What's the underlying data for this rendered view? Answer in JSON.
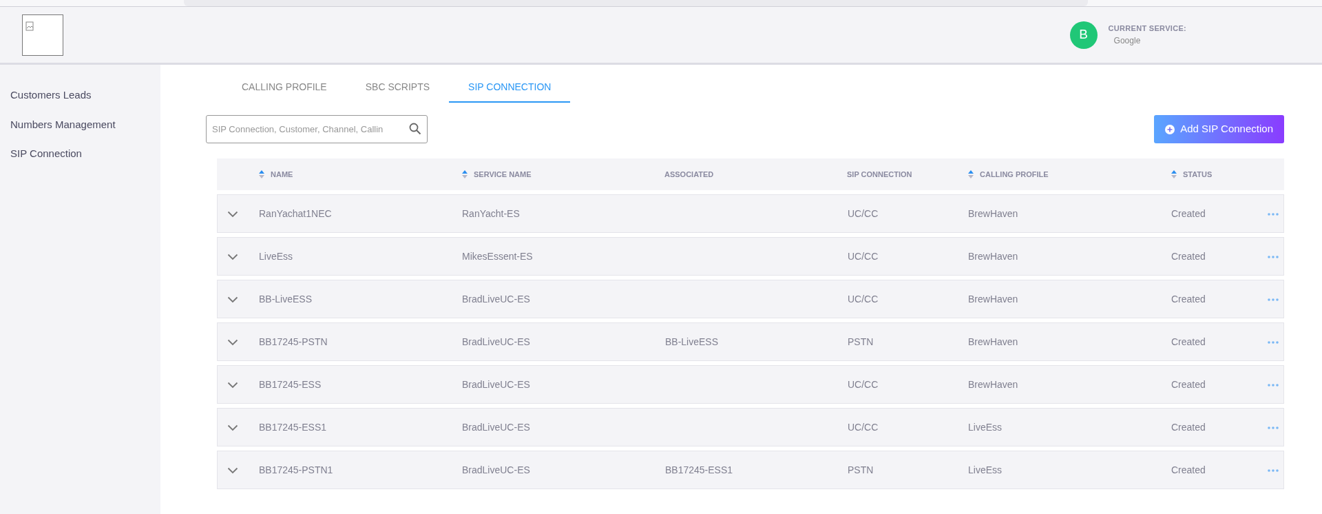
{
  "header": {
    "avatar_letter": "B",
    "service_label": "CURRENT SERVICE:",
    "service_name": "Google"
  },
  "sidebar": {
    "items": [
      {
        "label": "Customers Leads"
      },
      {
        "label": "Numbers Management"
      },
      {
        "label": "SIP Connection"
      }
    ]
  },
  "tabs": [
    {
      "label": "CALLING PROFILE",
      "selected": false
    },
    {
      "label": "SBC SCRIPTS",
      "selected": false
    },
    {
      "label": "SIP CONNECTION",
      "selected": true
    }
  ],
  "search": {
    "placeholder": "SIP Connection, Customer, Channel, Callin"
  },
  "add_button": {
    "label": "Add SIP Connection"
  },
  "table": {
    "columns": [
      {
        "label": "NAME",
        "sortable": true
      },
      {
        "label": "SERVICE NAME",
        "sortable": true
      },
      {
        "label": "ASSOCIATED",
        "sortable": false
      },
      {
        "label": "SIP CONNECTION",
        "sortable": false
      },
      {
        "label": "CALLING PROFILE",
        "sortable": true
      },
      {
        "label": "STATUS",
        "sortable": true
      }
    ],
    "rows": [
      {
        "cells": [
          "RanYachat1NEC",
          "RanYacht-ES",
          "",
          "UC/CC",
          "BrewHaven",
          "Created"
        ]
      },
      {
        "cells": [
          "LiveEss",
          "MikesEssent-ES",
          "",
          "UC/CC",
          "BrewHaven",
          "Created"
        ]
      },
      {
        "cells": [
          "BB-LiveESS",
          "BradLiveUC-ES",
          "",
          "UC/CC",
          "BrewHaven",
          "Created"
        ]
      },
      {
        "cells": [
          "BB17245-PSTN",
          "BradLiveUC-ES",
          "BB-LiveESS",
          "PSTN",
          "BrewHaven",
          "Created"
        ]
      },
      {
        "cells": [
          "BB17245-ESS",
          "BradLiveUC-ES",
          "",
          "UC/CC",
          "BrewHaven",
          "Created"
        ]
      },
      {
        "cells": [
          "BB17245-ESS1",
          "BradLiveUC-ES",
          "",
          "UC/CC",
          "LiveEss",
          "Created"
        ]
      },
      {
        "cells": [
          "BB17245-PSTN1",
          "BradLiveUC-ES",
          "BB17245-ESS1",
          "PSTN",
          "LiveEss",
          "Created"
        ]
      }
    ]
  }
}
